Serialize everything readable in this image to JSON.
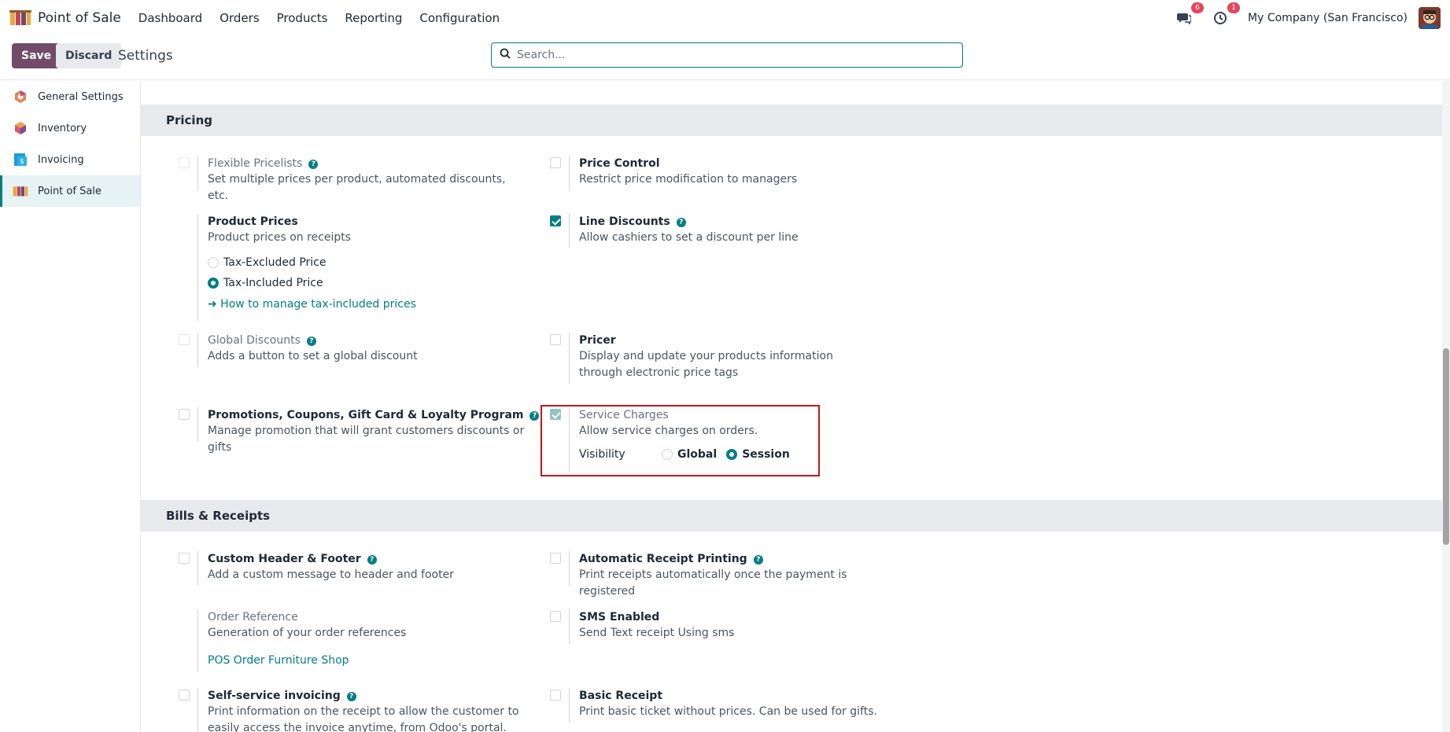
{
  "navbar": {
    "app_name": "Point of Sale",
    "menu": [
      "Dashboard",
      "Orders",
      "Products",
      "Reporting",
      "Configuration"
    ],
    "messages_badge": "6",
    "activities_badge": "1",
    "company": "My Company (San Francisco)"
  },
  "control": {
    "save": "Save",
    "discard": "Discard",
    "title": "Settings",
    "search_placeholder": "Search..."
  },
  "sidebar": {
    "items": [
      {
        "label": "General Settings",
        "icon": "general-settings-icon"
      },
      {
        "label": "Inventory",
        "icon": "inventory-icon"
      },
      {
        "label": "Invoicing",
        "icon": "invoicing-icon"
      },
      {
        "label": "Point of Sale",
        "icon": "point-of-sale-icon",
        "active": true
      }
    ]
  },
  "pricing": {
    "header": "Pricing",
    "flexible_pricelists": {
      "title": "Flexible Pricelists",
      "desc": "Set multiple prices per product, automated discounts, etc.",
      "checked": false
    },
    "price_control": {
      "title": "Price Control",
      "desc": "Restrict price modification to managers",
      "checked": false
    },
    "product_prices": {
      "title": "Product Prices",
      "desc": "Product prices on receipts",
      "option1": "Tax-Excluded Price",
      "option2": "Tax-Included Price",
      "selected": "Tax-Included Price",
      "link": "➜ How to manage tax-included prices"
    },
    "line_discounts": {
      "title": "Line Discounts",
      "desc": "Allow cashiers to set a discount per line",
      "checked": true
    },
    "global_discounts": {
      "title": "Global Discounts",
      "desc": "Adds a button to set a global discount",
      "checked": false
    },
    "pricer": {
      "title": "Pricer",
      "desc": "Display and update your products information through electronic price tags",
      "checked": false
    },
    "promotions": {
      "title": "Promotions, Coupons, Gift Card & Loyalty Program",
      "desc": "Manage promotion that will grant customers discounts or gifts",
      "checked": false
    },
    "service_charges": {
      "title": "Service Charges",
      "desc": "Allow service charges on orders.",
      "checked": true,
      "visibility_label": "Visibility",
      "option1": "Global",
      "option2": "Session",
      "selected": "Session"
    }
  },
  "bills": {
    "header": "Bills & Receipts",
    "custom_header": {
      "title": "Custom Header & Footer",
      "desc": "Add a custom message to header and footer",
      "checked": false
    },
    "auto_print": {
      "title": "Automatic Receipt Printing",
      "desc": "Print receipts automatically once the payment is registered",
      "checked": false
    },
    "order_reference": {
      "title": "Order Reference",
      "desc": "Generation of your order references",
      "link": "POS Order Furniture Shop"
    },
    "sms": {
      "title": "SMS Enabled",
      "desc": "Send Text receipt Using sms",
      "checked": false
    },
    "self_invoicing": {
      "title": "Self-service invoicing",
      "desc": "Print information on the receipt to allow the customer to easily access the invoice anytime, from Odoo's portal.",
      "checked": false
    },
    "basic_receipt": {
      "title": "Basic Receipt",
      "desc": "Print basic ticket without prices. Can be used for gifts.",
      "checked": false
    }
  },
  "colors": {
    "brand": "#714b67",
    "accent": "#017e84",
    "highlight": "#c0161b"
  }
}
